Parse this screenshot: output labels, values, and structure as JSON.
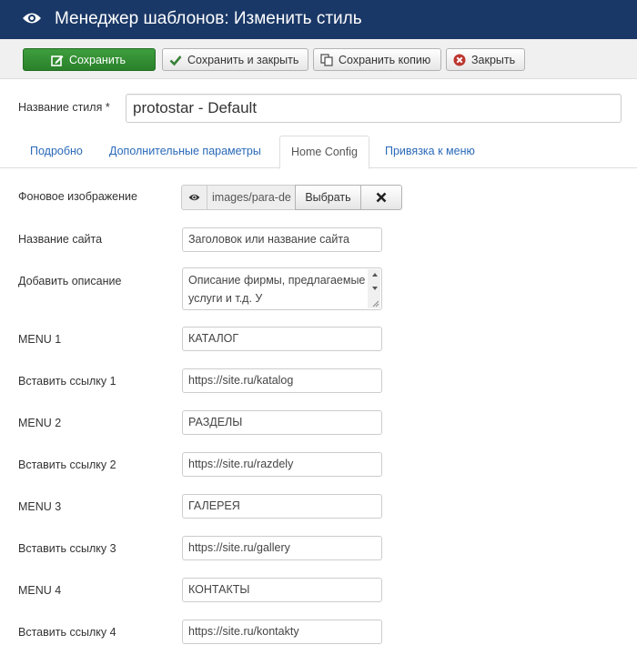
{
  "header": {
    "title": "Менеджер шаблонов: Изменить стиль",
    "icon": "eye-icon"
  },
  "toolbar": {
    "save_label": "Сохранить",
    "save_close_label": "Сохранить и закрыть",
    "save_copy_label": "Сохранить копию",
    "close_label": "Закрыть",
    "colors": {
      "save_bg": "#2f8a2f",
      "header_bg": "#1a3867",
      "close_icon": "#bd362f",
      "check_icon": "#378137"
    }
  },
  "style_name": {
    "label": "Название стиля *",
    "value": "protostar - Default"
  },
  "tabs": [
    {
      "label": "Подробно",
      "active": false
    },
    {
      "label": "Дополнительные параметры",
      "active": false
    },
    {
      "label": "Home Config",
      "active": true
    },
    {
      "label": "Привязка к меню",
      "active": false
    }
  ],
  "fields": {
    "bg_image": {
      "label": "Фоновое изображение",
      "value": "images/para-de",
      "select_label": "Выбрать"
    },
    "site_name": {
      "label": "Название сайта",
      "value": "Заголовок или название сайта"
    },
    "description": {
      "label": "Добавить описание",
      "value": "Описание фирмы, предлагаемые услуги и т.д. У"
    },
    "rows": [
      {
        "label": "MENU 1",
        "value": "КАТАЛОГ"
      },
      {
        "label": "Вставить ссылку 1",
        "value": "https://site.ru/katalog"
      },
      {
        "label": "MENU 2",
        "value": "РАЗДЕЛЫ"
      },
      {
        "label": "Вставить ссылку 2",
        "value": "https://site.ru/razdely"
      },
      {
        "label": "MENU 3",
        "value": "ГАЛЕРЕЯ"
      },
      {
        "label": "Вставить ссылку 3",
        "value": "https://site.ru/gallery"
      },
      {
        "label": "MENU 4",
        "value": "КОНТАКТЫ"
      },
      {
        "label": "Вставить ссылку 4",
        "value": "https://site.ru/kontakty"
      }
    ]
  }
}
